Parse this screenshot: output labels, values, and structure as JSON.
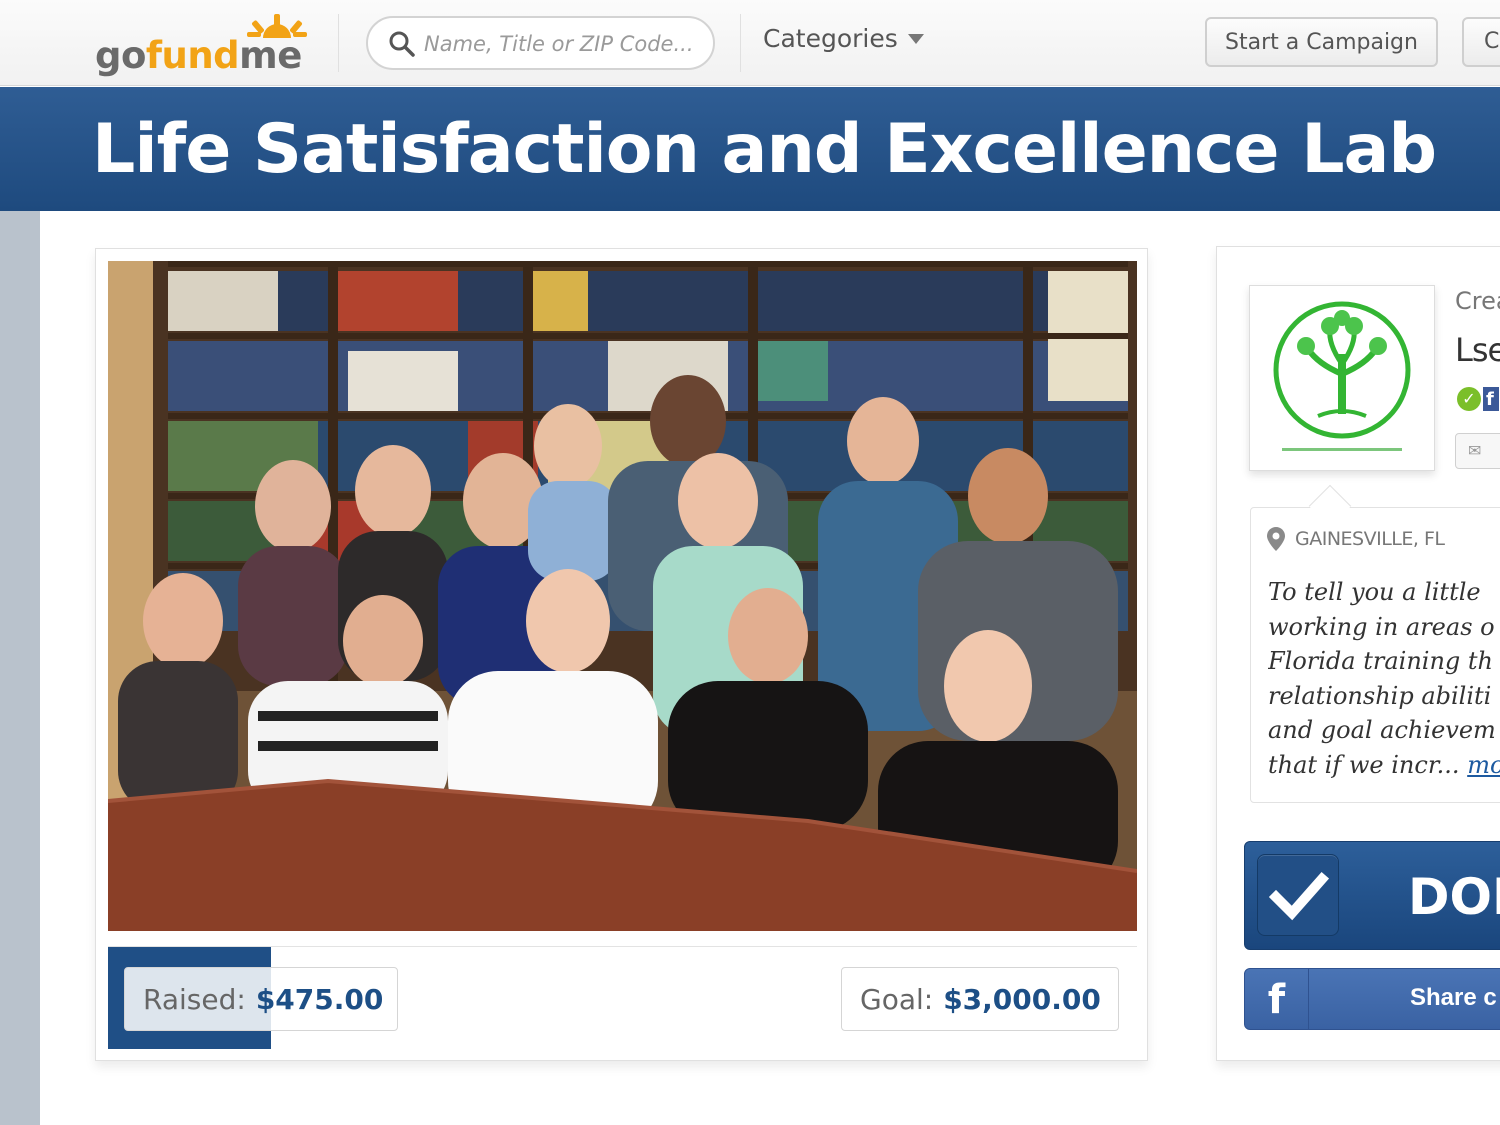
{
  "nav": {
    "logo": {
      "go": "go",
      "fund": "fund",
      "me": "me"
    },
    "search_placeholder": "Name, Title or ZIP Code...",
    "categories_label": "Categories",
    "start_campaign_label": "Start a Campaign",
    "cut_button_label": "C"
  },
  "campaign": {
    "title": "Life Satisfaction and Excellence Lab",
    "raised_label": "Raised:",
    "raised_amount": "$475.00",
    "goal_label": "Goal:",
    "goal_amount": "$3,000.00",
    "progress_fraction": 0.158
  },
  "sidebar": {
    "created_label": "Crea",
    "creator_name": "Lse",
    "location": "GAINESVILLE, FL",
    "story_lines": [
      "To tell you a little",
      "working in areas o",
      "Florida training th",
      "relationship abiliti",
      "and goal achievem",
      "that if we incr..."
    ],
    "more_link": "mo",
    "donate_label": "DOI",
    "share_label": "Share c",
    "share_icon": "f"
  },
  "colors": {
    "brand_blue": "#1f4f86",
    "brand_orange": "#f2a316",
    "logo_green": "#33b533"
  }
}
